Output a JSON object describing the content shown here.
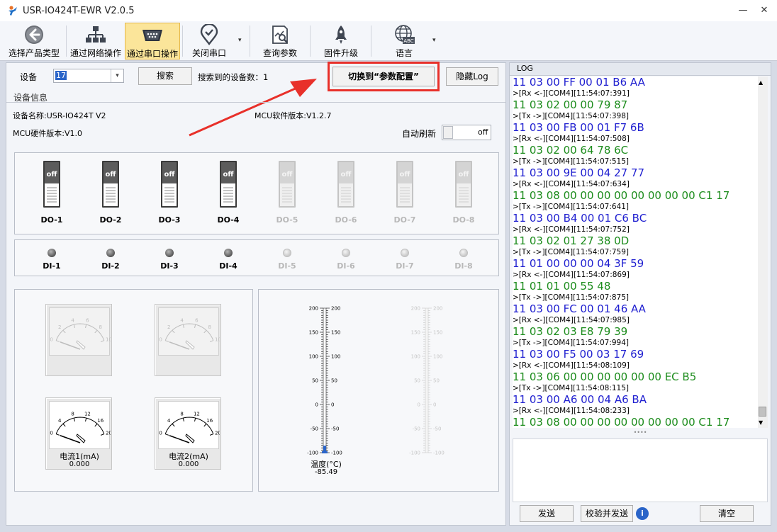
{
  "window": {
    "title": "USR-IO424T-EWR V2.0.5",
    "minimize": "—",
    "close": "✕"
  },
  "toolbar": {
    "items": [
      {
        "label": "选择产品类型",
        "icon": "back-arrow-icon"
      },
      {
        "label": "通过网络操作",
        "icon": "network-icon"
      },
      {
        "label": "通过串口操作",
        "icon": "serial-port-icon"
      },
      {
        "label": "关闭串口",
        "icon": "location-check-icon"
      },
      {
        "label": "查询参数",
        "icon": "query-document-icon"
      },
      {
        "label": "固件升级",
        "icon": "rocket-icon"
      },
      {
        "label": "语言",
        "icon": "globe-abc-icon"
      }
    ],
    "caret": "▾"
  },
  "device_bar": {
    "device_label": "设备",
    "device_value": "17",
    "search_button": "搜索",
    "found_label": "搜索到的设备数：",
    "found_count": "1",
    "switch_button": "切换到“参数配置”",
    "hide_log_button": "隐藏Log"
  },
  "device_info": {
    "section_title": "设备信息",
    "name_label": "设备名称:",
    "name_value": "USR-IO424T V2",
    "mcu_sw_label": "MCU软件版本:",
    "mcu_sw_value": "V1.2.7",
    "mcu_hw_label": "MCU硬件版本:",
    "mcu_hw_value": "V1.0",
    "auto_refresh_label": "自动刷新",
    "auto_refresh_state": "off"
  },
  "do_switches": [
    {
      "label": "DO-1",
      "state": "off",
      "enabled": true
    },
    {
      "label": "DO-2",
      "state": "off",
      "enabled": true
    },
    {
      "label": "DO-3",
      "state": "off",
      "enabled": true
    },
    {
      "label": "DO-4",
      "state": "off",
      "enabled": true
    },
    {
      "label": "DO-5",
      "state": "off",
      "enabled": false
    },
    {
      "label": "DO-6",
      "state": "off",
      "enabled": false
    },
    {
      "label": "DO-7",
      "state": "off",
      "enabled": false
    },
    {
      "label": "DO-8",
      "state": "off",
      "enabled": false
    }
  ],
  "di_inputs": [
    {
      "label": "DI-1",
      "enabled": true
    },
    {
      "label": "DI-2",
      "enabled": true
    },
    {
      "label": "DI-3",
      "enabled": true
    },
    {
      "label": "DI-4",
      "enabled": true
    },
    {
      "label": "DI-5",
      "enabled": false
    },
    {
      "label": "DI-6",
      "enabled": false
    },
    {
      "label": "DI-7",
      "enabled": false
    },
    {
      "label": "DI-8",
      "enabled": false
    }
  ],
  "gauges": [
    {
      "name": "",
      "value": "",
      "enabled": false,
      "ticks": [
        "0",
        "2",
        "4",
        "6",
        "8",
        "10"
      ]
    },
    {
      "name": "",
      "value": "",
      "enabled": false,
      "ticks": [
        "0",
        "2",
        "4",
        "6",
        "8",
        "10"
      ]
    },
    {
      "name": "电流1(mA)",
      "value": "0.000",
      "enabled": true,
      "ticks": [
        "0",
        "4",
        "8",
        "12",
        "16",
        "20"
      ]
    },
    {
      "name": "电流2(mA)",
      "value": "0.000",
      "enabled": true,
      "ticks": [
        "0",
        "4",
        "8",
        "12",
        "16",
        "20"
      ]
    }
  ],
  "thermometers": [
    {
      "name": "温度(°C)",
      "value": "-85.49",
      "reading": -85.49,
      "enabled": true,
      "ticks": [
        "200",
        "150",
        "100",
        "50",
        "0",
        "-50",
        "-100"
      ]
    },
    {
      "name": "",
      "value": "",
      "enabled": false,
      "ticks": [
        "200",
        "150",
        "100",
        "50",
        "0",
        "-50",
        "-100"
      ]
    }
  ],
  "log": {
    "title": "LOG",
    "lines": [
      {
        "kind": "tx",
        "text": "11 03 00 FF 00 01 B6 AA"
      },
      {
        "kind": "meta",
        "text": ">[Rx <-][COM4][11:54:07:391]"
      },
      {
        "kind": "rx",
        "text": "11 03 02 00 00 79 87"
      },
      {
        "kind": "meta",
        "text": ">[Tx ->][COM4][11:54:07:398]"
      },
      {
        "kind": "tx",
        "text": "11 03 00 FB 00 01 F7 6B"
      },
      {
        "kind": "meta",
        "text": ">[Rx <-][COM4][11:54:07:508]"
      },
      {
        "kind": "rx",
        "text": "11 03 02 00 64 78 6C"
      },
      {
        "kind": "meta",
        "text": ">[Tx ->][COM4][11:54:07:515]"
      },
      {
        "kind": "tx",
        "text": "11 03 00 9E 00 04 27 77"
      },
      {
        "kind": "meta",
        "text": ">[Rx <-][COM4][11:54:07:634]"
      },
      {
        "kind": "rx",
        "text": "11 03 08 00 00 00 00 00 00 00 00 C1 17"
      },
      {
        "kind": "meta",
        "text": ">[Tx ->][COM4][11:54:07:641]"
      },
      {
        "kind": "tx",
        "text": "11 03 00 B4 00 01 C6 BC"
      },
      {
        "kind": "meta",
        "text": ">[Rx <-][COM4][11:54:07:752]"
      },
      {
        "kind": "rx",
        "text": "11 03 02 01 27 38 0D"
      },
      {
        "kind": "meta",
        "text": ">[Tx ->][COM4][11:54:07:759]"
      },
      {
        "kind": "tx",
        "text": "11 01 00 00 00 04 3F 59"
      },
      {
        "kind": "meta",
        "text": ">[Rx <-][COM4][11:54:07:869]"
      },
      {
        "kind": "rx",
        "text": "11 01 01 00 55 48"
      },
      {
        "kind": "meta",
        "text": ">[Tx ->][COM4][11:54:07:875]"
      },
      {
        "kind": "tx",
        "text": "11 03 00 FC 00 01 46 AA"
      },
      {
        "kind": "meta",
        "text": ">[Rx <-][COM4][11:54:07:985]"
      },
      {
        "kind": "rx",
        "text": "11 03 02 03 E8 79 39"
      },
      {
        "kind": "meta",
        "text": ">[Tx ->][COM4][11:54:07:994]"
      },
      {
        "kind": "tx",
        "text": "11 03 00 F5 00 03 17 69"
      },
      {
        "kind": "meta",
        "text": ">[Rx <-][COM4][11:54:08:109]"
      },
      {
        "kind": "rx",
        "text": "11 03 06 00 00 00 00 00 00 EC B5"
      },
      {
        "kind": "meta",
        "text": ">[Tx ->][COM4][11:54:08:115]"
      },
      {
        "kind": "tx",
        "text": "11 03 00 A6 00 04 A6 BA"
      },
      {
        "kind": "meta",
        "text": ">[Rx <-][COM4][11:54:08:233]"
      },
      {
        "kind": "rx",
        "text": "11 03 08 00 00 00 00 00 00 00 00 C1 17"
      }
    ],
    "splitter_grip": "••••",
    "send_button": "发送",
    "verify_send_button": "校验并发送",
    "info_icon": "i",
    "clear_button": "清空"
  },
  "colors": {
    "tx": "#1f1fd0",
    "rx": "#1c8c1c",
    "highlight": "#e8302a",
    "toolbar_active": "#fbe59a"
  }
}
